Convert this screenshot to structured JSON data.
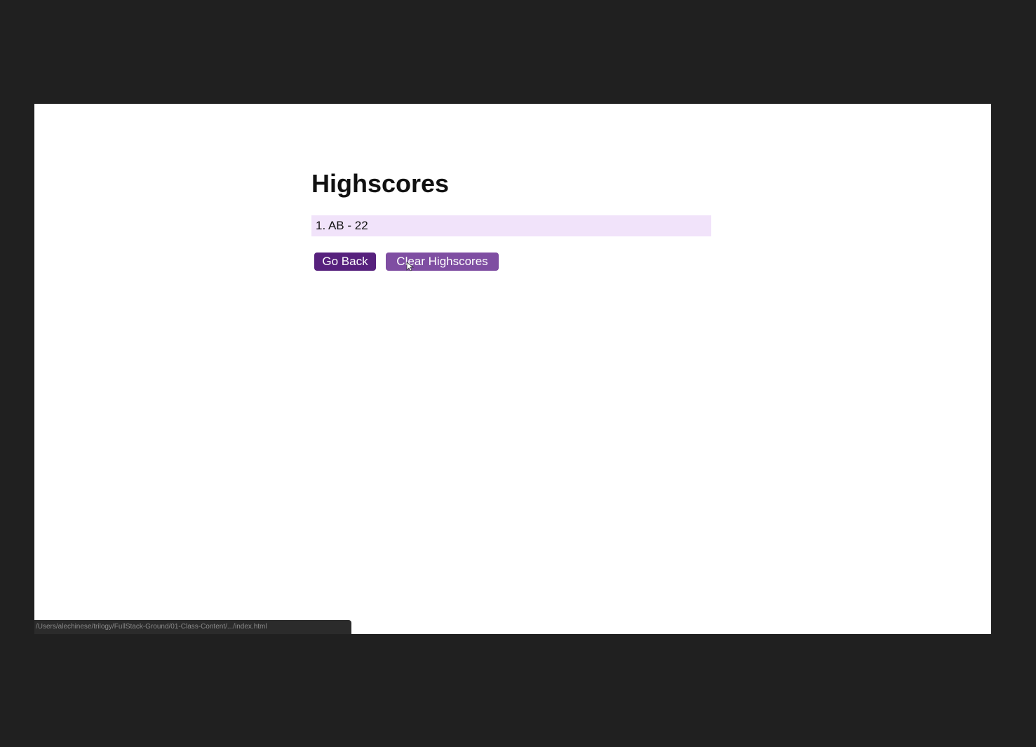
{
  "page": {
    "title": "Highscores"
  },
  "scores": [
    {
      "text": "1. AB - 22"
    }
  ],
  "buttons": {
    "go_back": "Go Back",
    "clear": "Clear Highscores"
  },
  "status_bar": {
    "url": "/Users/alechinese/trilogy/FullStack-Ground/01-Class-Content/.../index.html"
  },
  "colors": {
    "frame": "#202020",
    "score_bg": "#f1e3fa",
    "go_back_bg": "#57217d",
    "clear_bg": "#7f4ea2"
  },
  "icons": {
    "cursor": "arrow-cursor-icon"
  }
}
